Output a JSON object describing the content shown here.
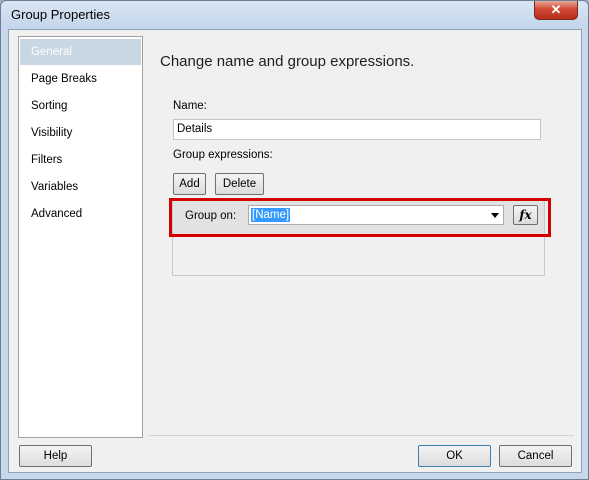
{
  "window": {
    "title": "Group Properties",
    "close_icon": "close-icon"
  },
  "sidebar": {
    "items": [
      {
        "label": "General"
      },
      {
        "label": "Page Breaks"
      },
      {
        "label": "Sorting"
      },
      {
        "label": "Visibility"
      },
      {
        "label": "Filters"
      },
      {
        "label": "Variables"
      },
      {
        "label": "Advanced"
      }
    ]
  },
  "main": {
    "heading": "Change name and group expressions.",
    "name_label": "Name:",
    "name_value": "Details",
    "group_expressions_label": "Group expressions:",
    "add_label": "Add",
    "delete_label": "Delete",
    "group_on_label": "Group on:",
    "group_on_value": "[Name]",
    "fx_label": "fx"
  },
  "footer": {
    "help_label": "Help",
    "ok_label": "OK",
    "cancel_label": "Cancel"
  },
  "colors": {
    "highlight": "#d40000",
    "selection": "#3399ff"
  }
}
